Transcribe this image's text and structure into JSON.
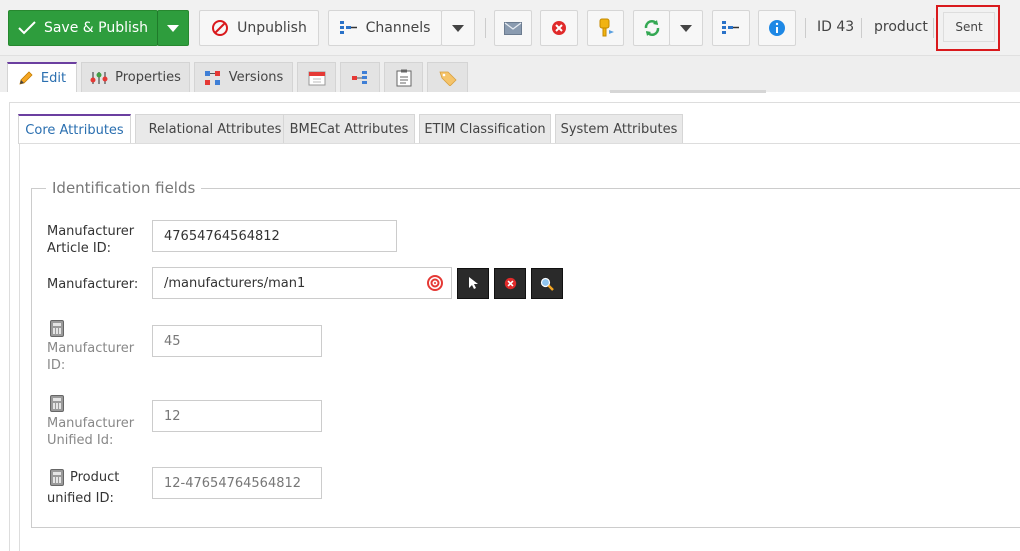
{
  "toolbar": {
    "save_publish": "Save & Publish",
    "unpublish": "Unpublish",
    "channels": "Channels",
    "id_label": "ID 43",
    "type_label": "product",
    "sent": "Sent"
  },
  "top_tabs": [
    {
      "label": "Edit",
      "icon": "pencil-icon",
      "active": true
    },
    {
      "label": "Properties",
      "icon": "properties-icon"
    },
    {
      "label": "Versions",
      "icon": "versions-icon"
    },
    {
      "label": "",
      "icon": "calendar-icon"
    },
    {
      "label": "",
      "icon": "dependencies-icon"
    },
    {
      "label": "",
      "icon": "clipboard-icon"
    },
    {
      "label": "",
      "icon": "tag-icon"
    }
  ],
  "sub_tabs": [
    {
      "label": "Core Attributes",
      "active": true
    },
    {
      "label": "Relational Attributes"
    },
    {
      "label": "BMECat Attributes"
    },
    {
      "label": "ETIM Classification"
    },
    {
      "label": "System Attributes"
    }
  ],
  "fieldset": {
    "legend": "Identification fields",
    "manufacturer_article_id": {
      "label_line1": "Manufacturer",
      "label_line2": "Article ID:",
      "value": "47654764564812"
    },
    "manufacturer": {
      "label": "Manufacturer:",
      "value": "/manufacturers/man1"
    },
    "manufacturer_id": {
      "label_line1": "Manufacturer",
      "label_line2": "ID:",
      "value": "45"
    },
    "manufacturer_unified_id": {
      "label_line1": "Manufacturer",
      "label_line2": "Unified Id:",
      "value": "12"
    },
    "product_unified_id": {
      "label_line1": "Product",
      "label_line2": "unified ID:",
      "value": "12-47654764564812"
    }
  },
  "colors": {
    "accent": "#6b3fa0",
    "publish": "#2e9d3d",
    "highlight": "#d9191c"
  }
}
